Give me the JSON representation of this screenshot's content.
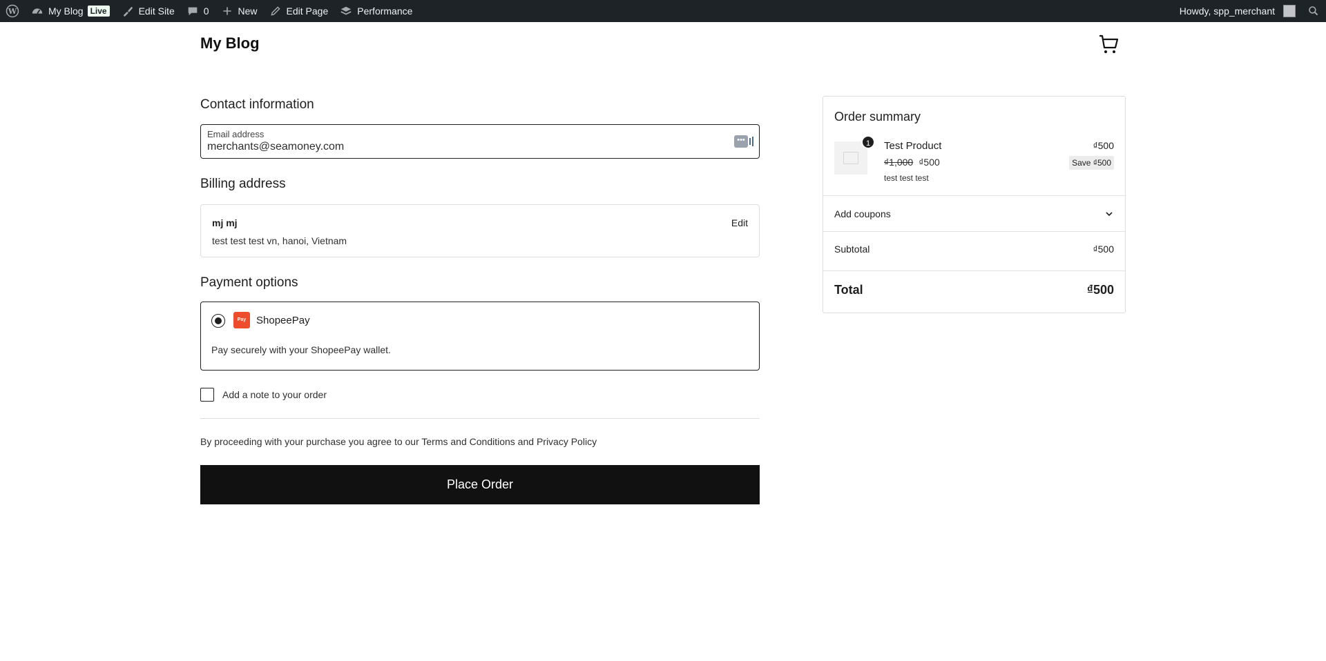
{
  "admin_bar": {
    "site_name": "My Blog",
    "live_badge": "Live",
    "edit_site": "Edit Site",
    "comments_count": "0",
    "new_label": "New",
    "edit_page": "Edit Page",
    "performance": "Performance",
    "howdy": "Howdy, spp_merchant"
  },
  "header": {
    "site_title": "My Blog"
  },
  "contact": {
    "title": "Contact information",
    "email_label": "Email address",
    "email_value": "merchants@seamoney.com"
  },
  "billing": {
    "title": "Billing address",
    "name": "mj mj",
    "address": "test test test vn, hanoi, Vietnam",
    "edit_label": "Edit"
  },
  "payment": {
    "title": "Payment options",
    "method_label": "ShopeePay",
    "logo_text": "Pay",
    "description": "Pay securely with your ShopeePay wallet."
  },
  "note": {
    "label": "Add a note to your order"
  },
  "terms": {
    "prefix": "By proceeding with your purchase you agree to our ",
    "terms_link": "Terms and Conditions",
    "middle": " and ",
    "privacy_link": "Privacy Policy"
  },
  "place_order": {
    "label": "Place Order"
  },
  "summary": {
    "title": "Order summary",
    "product": {
      "quantity": "1",
      "name": "Test Product",
      "line_total": "₫500",
      "regular_price": "₫1,000",
      "sale_price": "₫500",
      "save_badge": "Save ₫500",
      "description": "test test test"
    },
    "coupons_label": "Add coupons",
    "subtotal_label": "Subtotal",
    "subtotal_value": "₫500",
    "total_label": "Total",
    "total_value": "₫500"
  },
  "colors": {
    "admin_bar_bg": "#1d2327",
    "button_bg": "#111111",
    "shopee_orange": "#ee4d2d"
  }
}
